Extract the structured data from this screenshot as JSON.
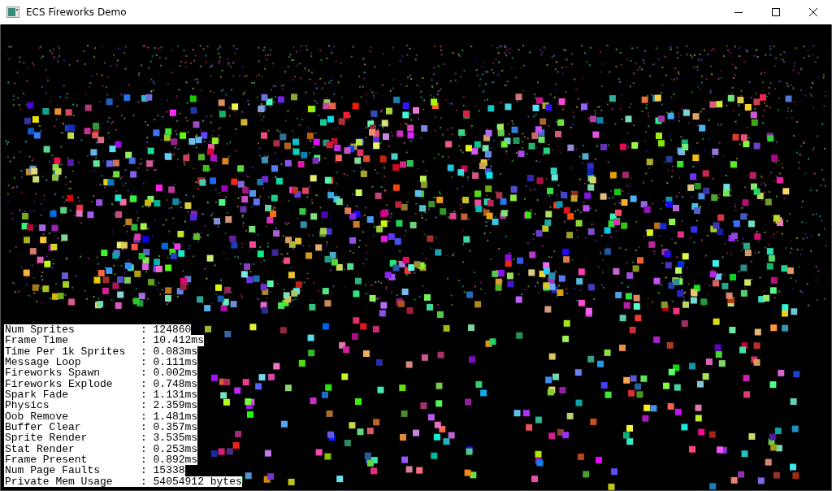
{
  "window": {
    "title": "ECS Fireworks Demo"
  },
  "stats": [
    {
      "label": "Num Sprites",
      "value": ": 124860"
    },
    {
      "label": "Frame Time",
      "value": ": 10.412ms"
    },
    {
      "label": "Time Per 1k Sprites",
      "value": ": 0.083ms"
    },
    {
      "label": "Message Loop",
      "value": ": 0.111ms"
    },
    {
      "label": "Fireworks Spawn",
      "value": ": 0.002ms"
    },
    {
      "label": "Fireworks Explode",
      "value": ": 0.748ms"
    },
    {
      "label": "Spark Fade",
      "value": ": 1.131ms"
    },
    {
      "label": "Physics",
      "value": ": 2.359ms"
    },
    {
      "label": "Oob Remove",
      "value": ": 1.481ms"
    },
    {
      "label": "Buffer Clear",
      "value": ": 0.357ms"
    },
    {
      "label": "Sprite Render",
      "value": ": 3.535ms"
    },
    {
      "label": "Stat Render",
      "value": ": 0.253ms"
    },
    {
      "label": "Frame Present",
      "value": ": 0.892ms"
    },
    {
      "label": "Num Page Faults",
      "value": ": 15338"
    },
    {
      "label": "Private Mem Usage",
      "value": ": 54054912 bytes"
    }
  ]
}
